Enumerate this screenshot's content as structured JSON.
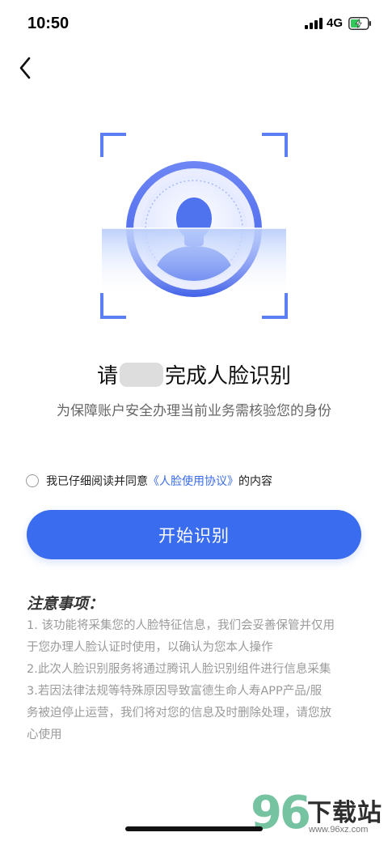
{
  "status_bar": {
    "time": "10:50",
    "network": "4G",
    "battery_level": 0.6,
    "battery_color": "#34c759"
  },
  "header": {
    "back_icon": "chevron-left-icon"
  },
  "face": {
    "icon": "face-scan-icon",
    "accent_color": "#4a6cf0"
  },
  "main": {
    "title_prefix": "请",
    "title_suffix": "完成人脸识别",
    "subtitle": "为保障账户安全办理当前业务需核验您的身份"
  },
  "agreement": {
    "prefix": "我已仔细阅读并同意",
    "link_text": "《人脸使用协议》",
    "suffix": "的内容",
    "checked": false
  },
  "start_button": {
    "label": "开始识别",
    "color": "#3a6cf0"
  },
  "notice": {
    "title": "注意事项：",
    "lines": [
      "1. 该功能将采集您的人脸特征信息，我们会妥善保管并仅用",
      "于您办理人脸认证时使用，以确认为您本人操作",
      "2.此次人脸识别服务将通过腾讯人脸识别组件进行信息采集",
      "3.若因法律法规等特殊原因导致富德生命人寿APP产品/服",
      "务被迫停止运营，我们将对您的信息及时删除处理，请您放",
      "心使用"
    ]
  },
  "watermark": {
    "number": "96",
    "text": "下载站",
    "url": "www.96xz.com"
  }
}
